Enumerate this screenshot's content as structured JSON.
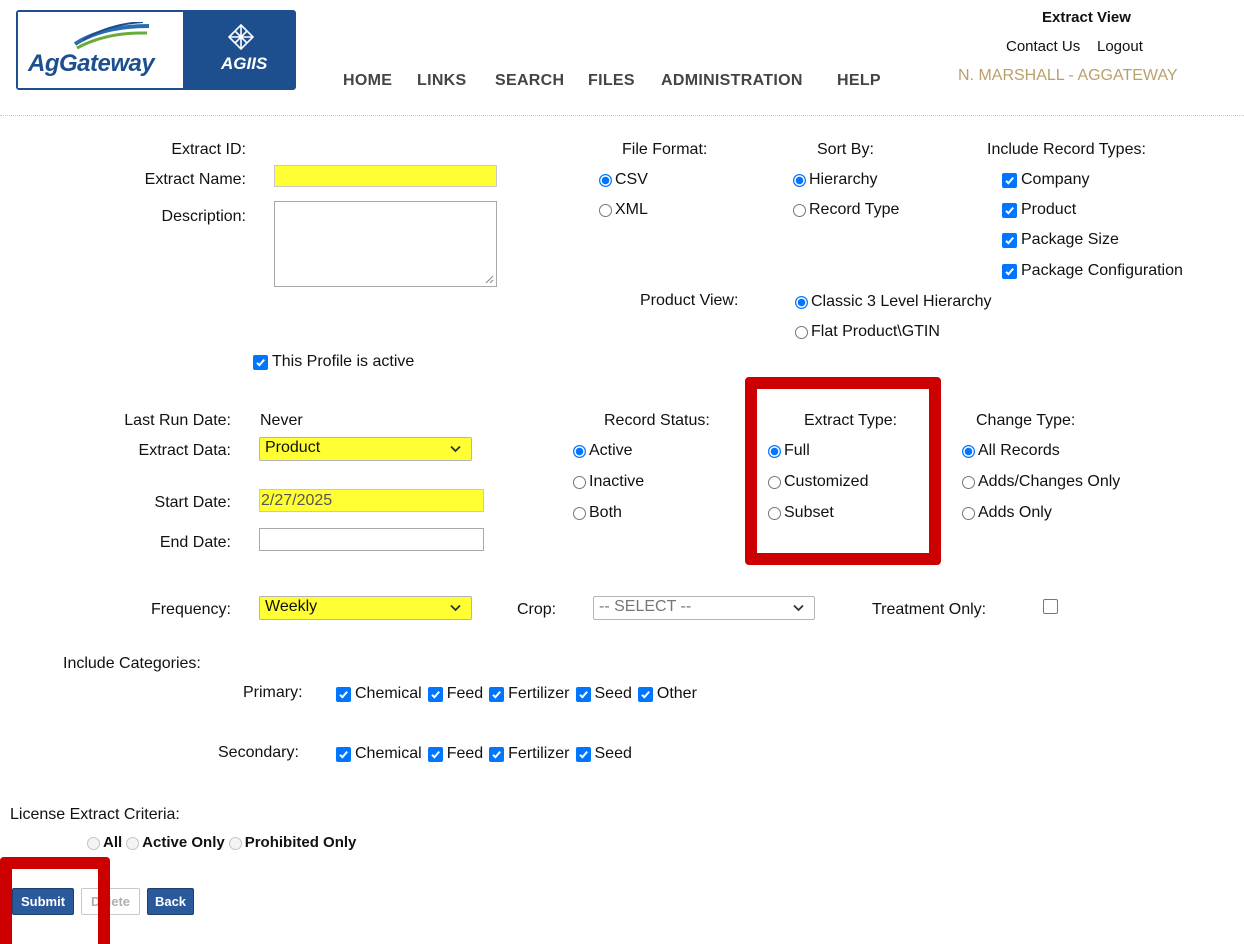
{
  "header": {
    "logo_left": "AgGateway",
    "logo_right": "AGIIS",
    "nav": [
      "HOME",
      "LINKS",
      "SEARCH",
      "FILES",
      "ADMINISTRATION",
      "HELP"
    ],
    "page_title": "Extract View",
    "contact": "Contact Us",
    "logout": "Logout",
    "user": "N. MARSHALL - AGGATEWAY"
  },
  "form": {
    "extract_id_label": "Extract ID:",
    "extract_name_label": "Extract Name:",
    "extract_name_value": "",
    "description_label": "Description:",
    "description_value": "",
    "active_profile_label": "This Profile is active",
    "file_format": {
      "label": "File Format:",
      "options": [
        "CSV",
        "XML"
      ],
      "selected": "CSV"
    },
    "sort_by": {
      "label": "Sort By:",
      "options": [
        "Hierarchy",
        "Record Type"
      ],
      "selected": "Hierarchy"
    },
    "record_types": {
      "label": "Include Record Types:",
      "options": [
        "Company",
        "Product",
        "Package Size",
        "Package Configuration"
      ]
    },
    "product_view": {
      "label": "Product View:",
      "options": [
        "Classic 3 Level Hierarchy",
        "Flat Product\\GTIN"
      ],
      "selected": "Classic 3 Level Hierarchy"
    },
    "last_run_label": "Last Run Date:",
    "last_run_value": "Never",
    "extract_data_label": "Extract Data:",
    "extract_data_value": "Product",
    "start_date_label": "Start Date:",
    "start_date_value": "2/27/2025",
    "end_date_label": "End Date:",
    "end_date_value": "",
    "record_status": {
      "label": "Record Status:",
      "options": [
        "Active",
        "Inactive",
        "Both"
      ],
      "selected": "Active"
    },
    "extract_type": {
      "label": "Extract Type:",
      "options": [
        "Full",
        "Customized",
        "Subset"
      ],
      "selected": "Full"
    },
    "change_type": {
      "label": "Change Type:",
      "options": [
        "All Records",
        "Adds/Changes Only",
        "Adds Only"
      ],
      "selected": "All Records"
    },
    "frequency_label": "Frequency:",
    "frequency_value": "Weekly",
    "crop_label": "Crop:",
    "crop_value": "-- SELECT --",
    "treatment_label": "Treatment Only:",
    "categories_label": "Include Categories:",
    "primary_label": "Primary:",
    "primary_options": [
      "Chemical",
      "Feed",
      "Fertilizer",
      "Seed",
      "Other"
    ],
    "secondary_label": "Secondary:",
    "secondary_options": [
      "Chemical",
      "Feed",
      "Fertilizer",
      "Seed"
    ],
    "license_label": "License Extract Criteria:",
    "license_options": [
      "All",
      "Active Only",
      "Prohibited Only"
    ]
  },
  "buttons": {
    "submit": "Submit",
    "delete": "Delete",
    "back": "Back"
  },
  "colors": {
    "highlight": "#ffff33",
    "accent_blue": "#0075ff",
    "button_blue": "#2a5a9c",
    "annotation_red": "#cc0000",
    "user_gold": "#b9a06b"
  }
}
